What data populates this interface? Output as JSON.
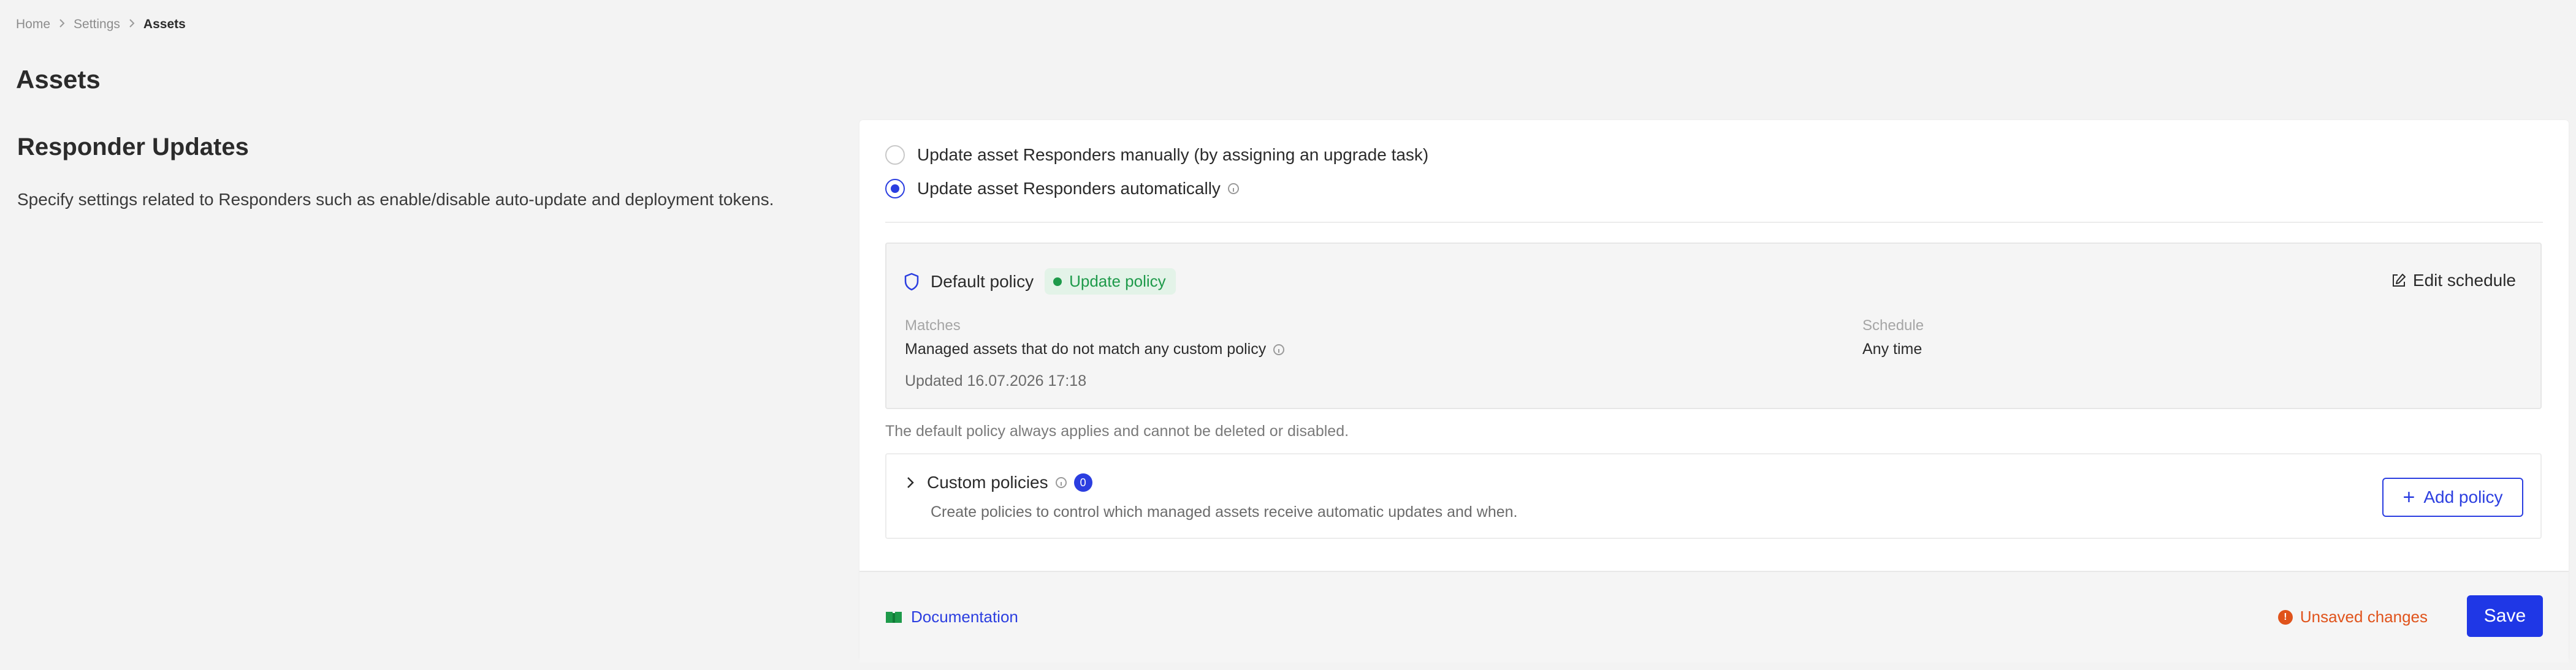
{
  "breadcrumb": {
    "items": [
      "Home",
      "Settings"
    ],
    "current": "Assets"
  },
  "page": {
    "title": "Assets"
  },
  "section": {
    "title": "Responder Updates",
    "description": "Specify settings related to Responders such as enable/disable auto-update and deployment tokens."
  },
  "update_mode": {
    "options": [
      {
        "label": "Update asset Responders manually (by assigning an upgrade task)",
        "selected": false
      },
      {
        "label": "Update asset Responders automatically",
        "selected": true
      }
    ]
  },
  "default_policy": {
    "name": "Default policy",
    "badge": "Update policy",
    "edit_label": "Edit schedule",
    "matches_label": "Matches",
    "matches_value": "Managed assets that do not match any custom policy",
    "schedule_label": "Schedule",
    "schedule_value": "Any time",
    "updated": "Updated 16.07.2026 17:18",
    "note": "The default policy always applies and cannot be deleted or disabled."
  },
  "custom_policies": {
    "title": "Custom policies",
    "count": "0",
    "description": "Create policies to control which managed assets receive automatic updates and when.",
    "add_label": "Add policy"
  },
  "footer": {
    "documentation_label": "Documentation",
    "unsaved_label": "Unsaved changes",
    "save_label": "Save"
  },
  "colors": {
    "accent": "#1f37e6",
    "success": "#1e9a4a",
    "warning": "#e0531b",
    "background": "#f3f3f3"
  },
  "icons": [
    "chevron-right-icon",
    "info-icon",
    "shield-icon",
    "edit-icon",
    "chevron-right-icon",
    "plus-icon",
    "book-icon",
    "warning-icon"
  ]
}
